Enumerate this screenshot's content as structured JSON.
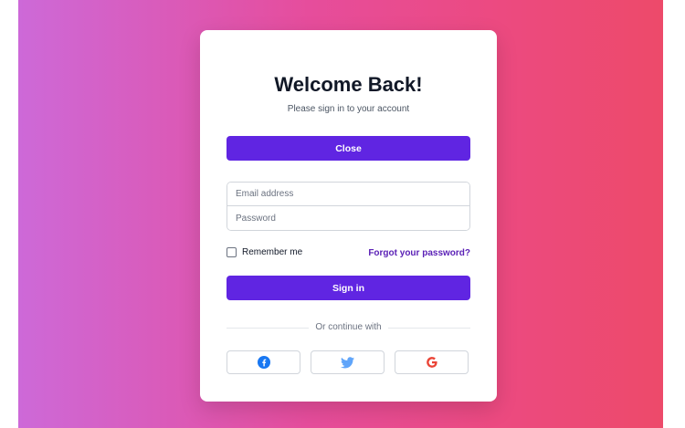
{
  "login": {
    "title": "Welcome Back!",
    "subtitle": "Please sign in to your account",
    "close_label": "Close",
    "email_placeholder": "Email address",
    "password_placeholder": "Password",
    "remember_label": "Remember me",
    "forgot_label": "Forgot your password?",
    "signin_label": "Sign in",
    "divider_label": "Or continue with",
    "social": [
      {
        "icon": "facebook-icon",
        "color": "#1877f2"
      },
      {
        "icon": "twitter-icon",
        "color": "#60a5fa"
      },
      {
        "icon": "google-icon",
        "color": "#ea4335"
      }
    ]
  },
  "colors": {
    "accent": "#6025e2",
    "gradient_start": "#cd69d8",
    "gradient_end": "#ed4a6a",
    "link": "#5b21b6"
  }
}
